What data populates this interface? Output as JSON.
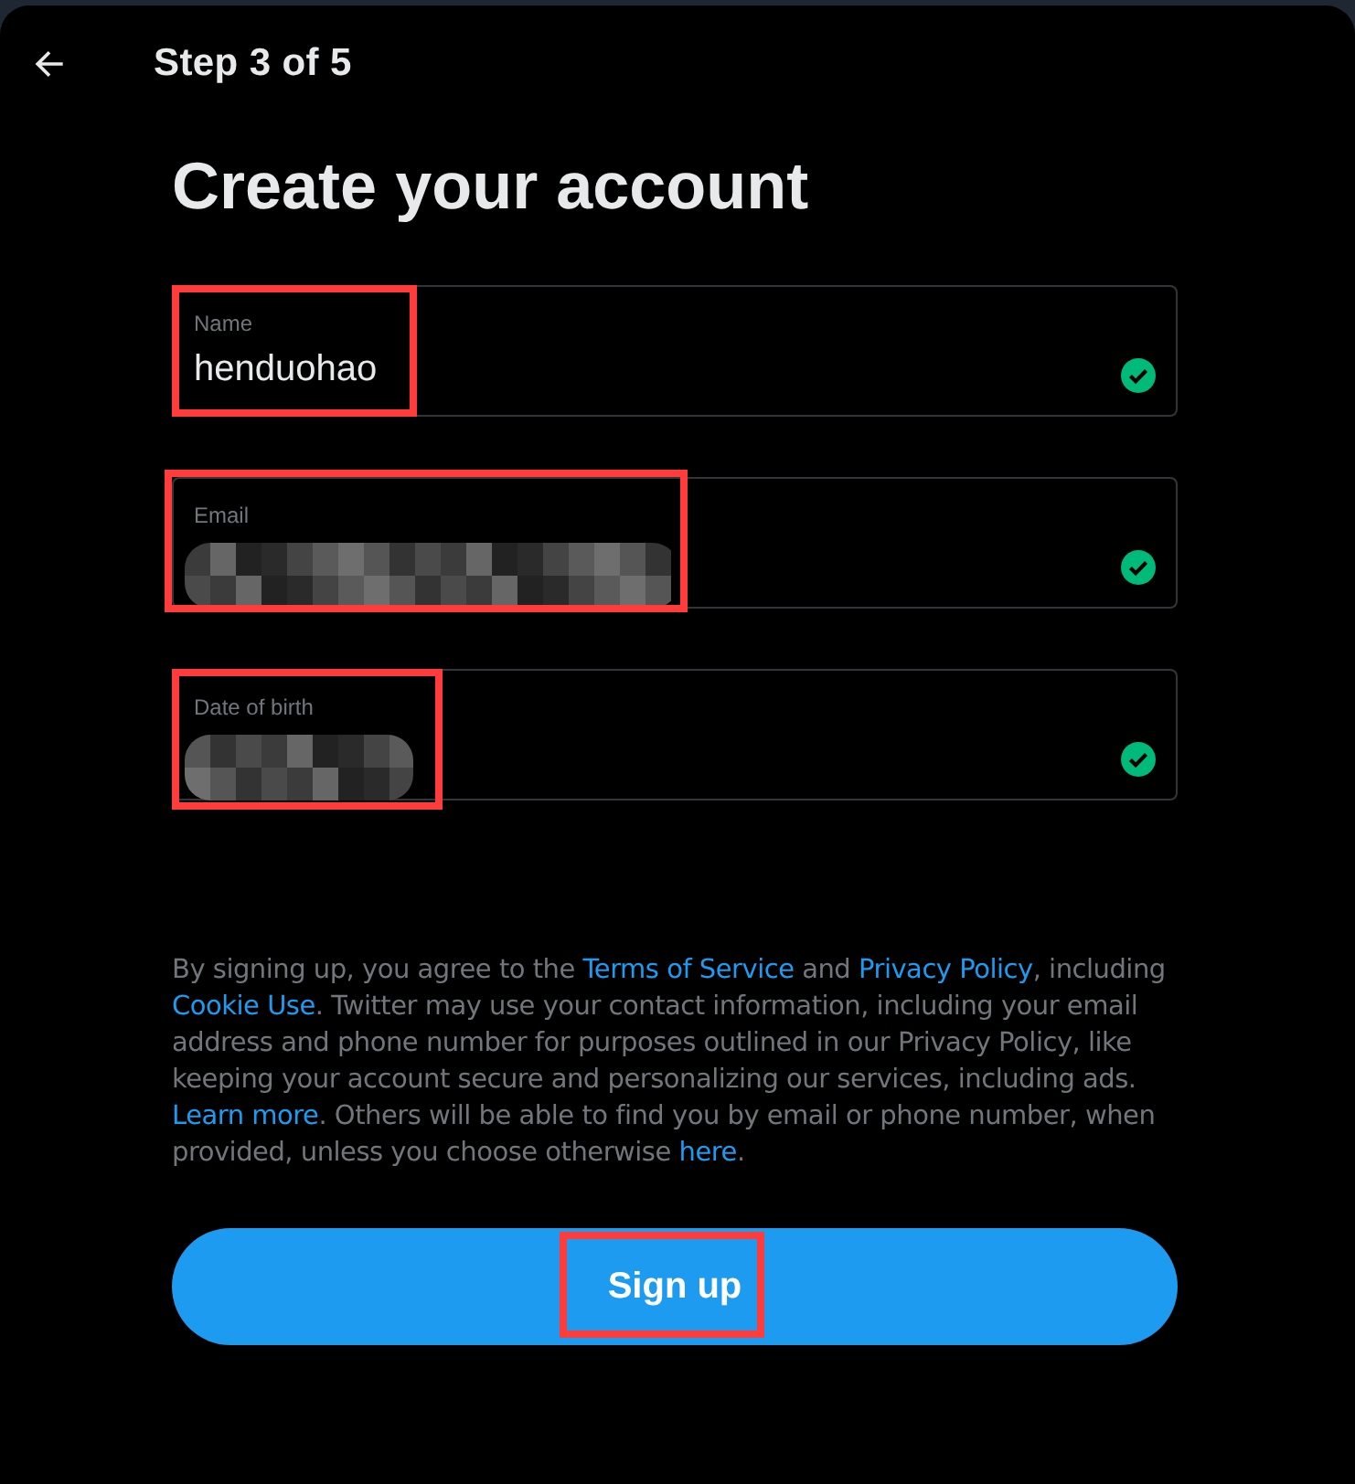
{
  "header": {
    "title": "Step 3 of 5"
  },
  "heading": "Create your account",
  "fields": [
    {
      "label": "Name",
      "kind": "text",
      "value": "henduohao",
      "valid": true,
      "highlighted": true
    },
    {
      "label": "Email",
      "kind": "redacted",
      "valid": true,
      "highlighted": true
    },
    {
      "label": "Date of birth",
      "kind": "redacted",
      "valid": true,
      "highlighted": true
    }
  ],
  "disclaimer": [
    {
      "kind": "text",
      "text": "By signing up, you agree to the "
    },
    {
      "kind": "link",
      "text": "Terms of Service"
    },
    {
      "kind": "text",
      "text": " and "
    },
    {
      "kind": "link",
      "text": "Privacy Policy"
    },
    {
      "kind": "text",
      "text": ", including "
    },
    {
      "kind": "link",
      "text": "Cookie Use"
    },
    {
      "kind": "text",
      "text": ". Twitter may use your contact information, including your email address and phone number for purposes outlined in our Privacy Policy, like keeping your account secure and personalizing our services, including ads. "
    },
    {
      "kind": "link",
      "text": "Learn more"
    },
    {
      "kind": "text",
      "text": ". Others will be able to find you by email or phone number, when provided, unless you choose otherwise "
    },
    {
      "kind": "link",
      "text": "here"
    },
    {
      "kind": "text",
      "text": "."
    }
  ],
  "submit": {
    "label": "Sign up",
    "highlighted": true
  }
}
